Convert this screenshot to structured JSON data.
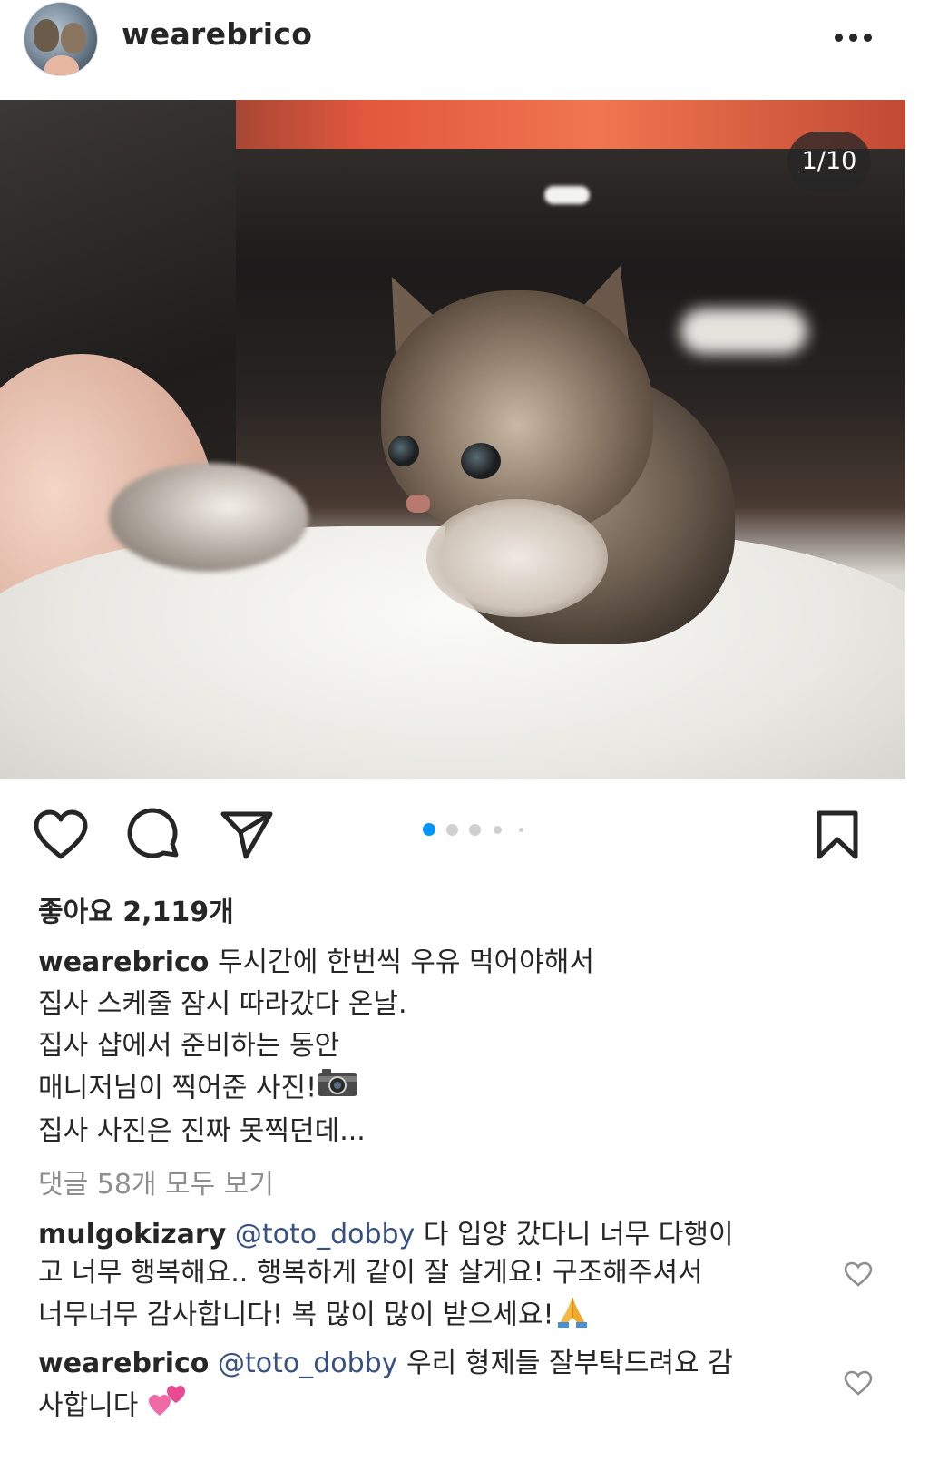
{
  "post": {
    "author": "wearebrico",
    "photo_counter": "1/10",
    "likes_text": "좋아요 2,119개",
    "caption_user": "wearebrico",
    "caption_lines": [
      "두시간에 한번씩 우유 먹어야해서",
      "집사 스케줄 잠시 따라갔다 온날.",
      "집사 샵에서 준비하는 동안",
      "매니저님이 찍어준 사진!",
      "집사 사진은 진짜 못찍던데..."
    ],
    "view_comments": "댓글 58개 모두 보기",
    "comments": [
      {
        "user": "mulgokizary",
        "mention": "@toto_dobby",
        "lines": [
          "다 입양 갔다니 너무 다행이",
          "고 너무 행복해요.. 행복하게 같이 잘 살게요! 구조해주셔서",
          "너무너무 감사합니다! 복 많이 많이 받으세요!"
        ]
      },
      {
        "user": "wearebrico",
        "mention": "@toto_dobby",
        "lines": [
          "우리 형제들 잘부탁드려요 감",
          "사합니다"
        ]
      }
    ]
  },
  "icons": {
    "more": "more-options-icon",
    "like": "heart-icon",
    "comment": "comment-icon",
    "share": "send-icon",
    "save": "bookmark-icon",
    "camera_emoji": "camera-emoji",
    "pray_emoji": "folded-hands-emoji",
    "hearts_emoji": "two-hearts-emoji"
  },
  "carousel": {
    "total_visible_dots": 5,
    "active_index": 0,
    "active_color": "#0095f6"
  },
  "colors": {
    "text": "#262626",
    "muted": "#8e8e8e",
    "mention": "#385185"
  }
}
